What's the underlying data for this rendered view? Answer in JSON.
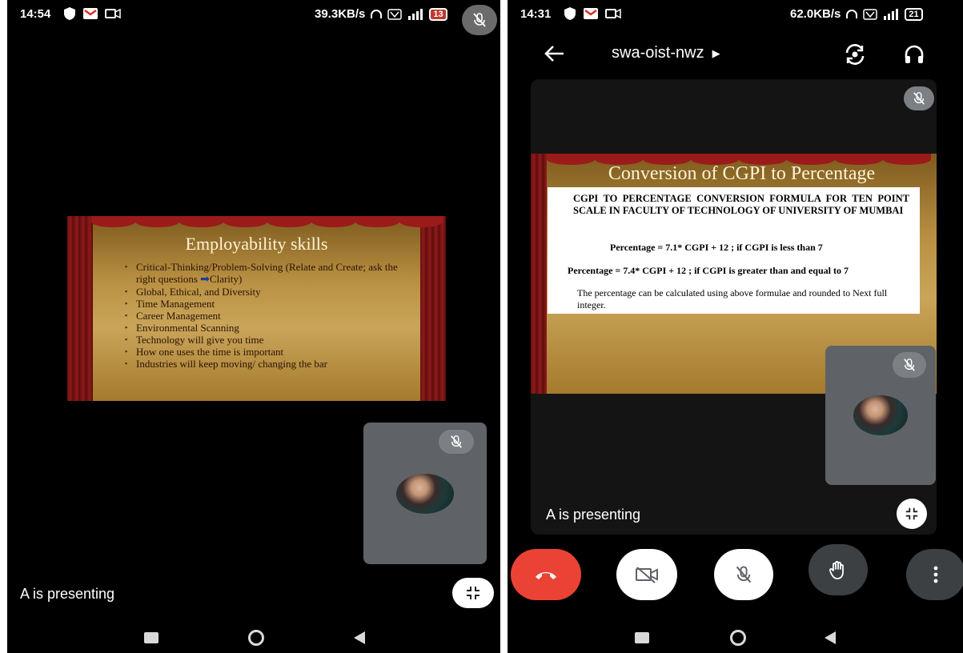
{
  "left": {
    "status": {
      "time": "14:54",
      "speed": "39.3KB/s",
      "battery": "13"
    },
    "slide": {
      "title": "Employability skills",
      "bullets": [
        "Critical-Thinking/Problem-Solving (Relate and Create; ask the right questions",
        "Global, Ethical, and Diversity",
        "Time Management",
        "Career Management",
        "Environmental Scanning",
        "Technology will give you time",
        "How one uses the time is important",
        "Industries will keep moving/ changing the bar"
      ],
      "bullet_suffix": "Clarity)"
    },
    "presenting_text": "A is presenting"
  },
  "right": {
    "status": {
      "time": "14:31",
      "speed": "62.0KB/s",
      "battery": "21"
    },
    "header": {
      "meeting_code": "swa-oist-nwz"
    },
    "slide": {
      "title": "Conversion of CGPI to Percentage",
      "heading": "CGPI TO PERCENTAGE CONVERSION FORMULA FOR TEN POINT SCALE IN FACULTY OF TECHNOLOGY OF UNIVERSITY OF MUMBAI",
      "formula1": "Percentage = 7.1* CGPI + 12 ; if CGPI is less than 7",
      "formula2": "Percentage = 7.4* CGPI + 12 ; if CGPI is greater than and equal to 7",
      "note": "The percentage can be calculated using above formulae and rounded to Next full integer."
    },
    "presenting_text": "A is presenting"
  },
  "colors": {
    "end_call": "#ea4335",
    "tile": "#5f6368",
    "white_button": "#ffffff",
    "dark_button": "#3c4043"
  }
}
